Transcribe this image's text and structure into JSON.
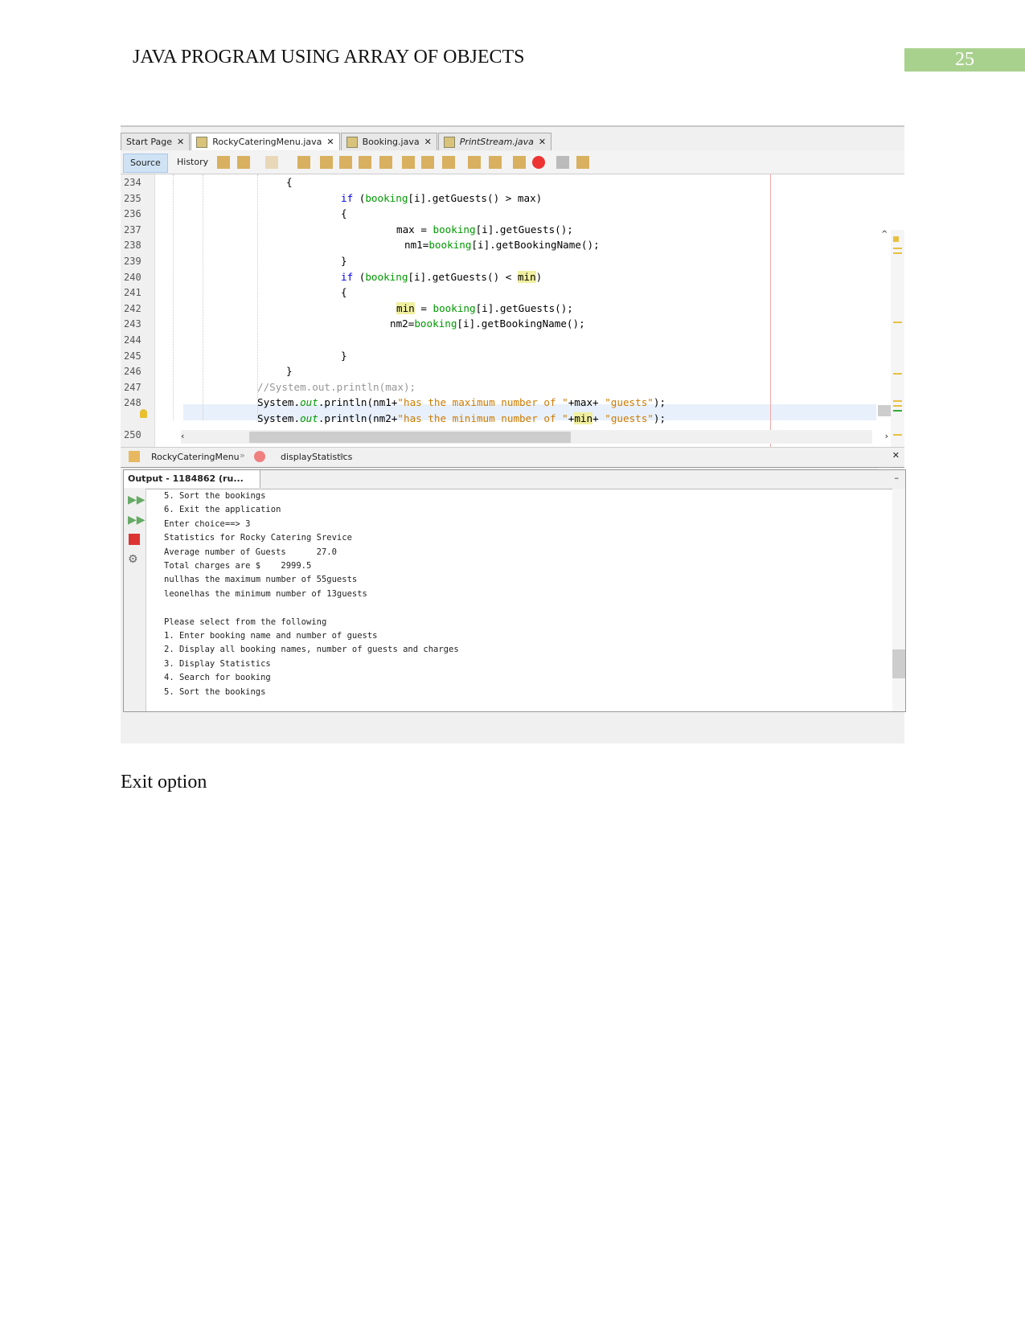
{
  "header": {
    "title": "JAVA PROGRAM USING ARRAY OF OBJECTS",
    "page_number": "25",
    "accent": "#a9d18e"
  },
  "ide": {
    "tabs": [
      {
        "label": "Start Page",
        "active": false
      },
      {
        "label": "RockyCateringMenu.java",
        "active": true
      },
      {
        "label": "Booking.java",
        "active": false
      },
      {
        "label": "PrintStream.java",
        "active": false,
        "italic": true
      }
    ],
    "source_label": "Source",
    "history_label": "History",
    "line_numbers": [
      "234",
      "235",
      "236",
      "237",
      "238",
      "239",
      "240",
      "241",
      "242",
      "243",
      "244",
      "245",
      "246",
      "247",
      "248",
      "",
      "250"
    ],
    "code": [
      {
        "indent": 0,
        "tokens": [
          [
            "{",
            ""
          ]
        ]
      },
      {
        "indent": 1,
        "tokens": [
          [
            "if",
            "kw"
          ],
          [
            " (",
            ""
          ],
          [
            "booking",
            "fld"
          ],
          [
            "[i].getGuests() > max)",
            ""
          ]
        ]
      },
      {
        "indent": 1,
        "tokens": [
          [
            "{",
            ""
          ]
        ]
      },
      {
        "indent": 2,
        "tokens": [
          [
            "max = ",
            ""
          ],
          [
            "booking",
            "fld"
          ],
          [
            "[i].getGuests();",
            ""
          ]
        ]
      },
      {
        "indent": 3,
        "tokens": [
          [
            "nm1=",
            ""
          ],
          [
            "booking",
            "fld"
          ],
          [
            "[i].getBookingName();",
            ""
          ]
        ]
      },
      {
        "indent": 1,
        "tokens": [
          [
            "}",
            ""
          ]
        ]
      },
      {
        "indent": 1,
        "tokens": [
          [
            "if",
            "kw"
          ],
          [
            " (",
            ""
          ],
          [
            "booking",
            "fld"
          ],
          [
            "[i].getGuests() < ",
            ""
          ],
          [
            "min",
            "hl"
          ],
          [
            ")",
            ""
          ]
        ]
      },
      {
        "indent": 1,
        "tokens": [
          [
            "{",
            ""
          ]
        ]
      },
      {
        "indent": 2,
        "tokens": [
          [
            "min",
            "hl"
          ],
          [
            " = ",
            ""
          ],
          [
            "booking",
            "fld"
          ],
          [
            "[i].getGuests();",
            ""
          ]
        ]
      },
      {
        "indent": 4,
        "tokens": [
          [
            "nm2=",
            ""
          ],
          [
            "booking",
            "fld"
          ],
          [
            "[i].getBookingName();",
            ""
          ]
        ]
      },
      {
        "indent": 1,
        "tokens": []
      },
      {
        "indent": 1,
        "tokens": [
          [
            "}",
            ""
          ]
        ]
      },
      {
        "indent": 0,
        "tokens": [
          [
            "}",
            ""
          ]
        ]
      },
      {
        "indent": 5,
        "tokens": [
          [
            "//System.out.println(max);",
            "cmt"
          ]
        ]
      },
      {
        "indent": 5,
        "tokens": [
          [
            "System.",
            ""
          ],
          [
            "out",
            "ital"
          ],
          [
            ".println(nm1+",
            ""
          ],
          [
            "\"has the maximum number of \"",
            "str"
          ],
          [
            "+max+ ",
            ""
          ],
          [
            "\"guests\"",
            "str"
          ],
          [
            ");",
            ""
          ]
        ]
      },
      {
        "indent": 5,
        "tokens": [
          [
            "System.",
            ""
          ],
          [
            "out",
            "ital"
          ],
          [
            ".println(nm2+",
            ""
          ],
          [
            "\"has the minimum number of \"",
            "str"
          ],
          [
            "+",
            ""
          ],
          [
            "min",
            "hl"
          ],
          [
            "+ ",
            ""
          ],
          [
            "\"guests\"",
            "str"
          ],
          [
            ");",
            ""
          ]
        ]
      },
      {
        "indent": 5,
        "tokens": []
      }
    ],
    "breadcrumbs": [
      "RockyCateringMenu",
      "displayStatistics"
    ],
    "output_tab": "Output - 1184862 (ru...",
    "output_lines": [
      "5. Sort the bookings",
      "6. Exit the application",
      "Enter choice==> 3",
      "Statistics for Rocky Catering Srevice",
      "Average number of Guests      27.0",
      "Total charges are $    2999.5",
      "nullhas the maximum number of 55guests",
      "leonelhas the minimum number of 13guests",
      "",
      "Please select from the following",
      "1. Enter booking name and number of guests",
      "2. Display all booking names, number of guests and charges",
      "3. Display Statistics",
      "4. Search for booking",
      "5. Sort the bookings"
    ]
  },
  "caption": "Exit option"
}
